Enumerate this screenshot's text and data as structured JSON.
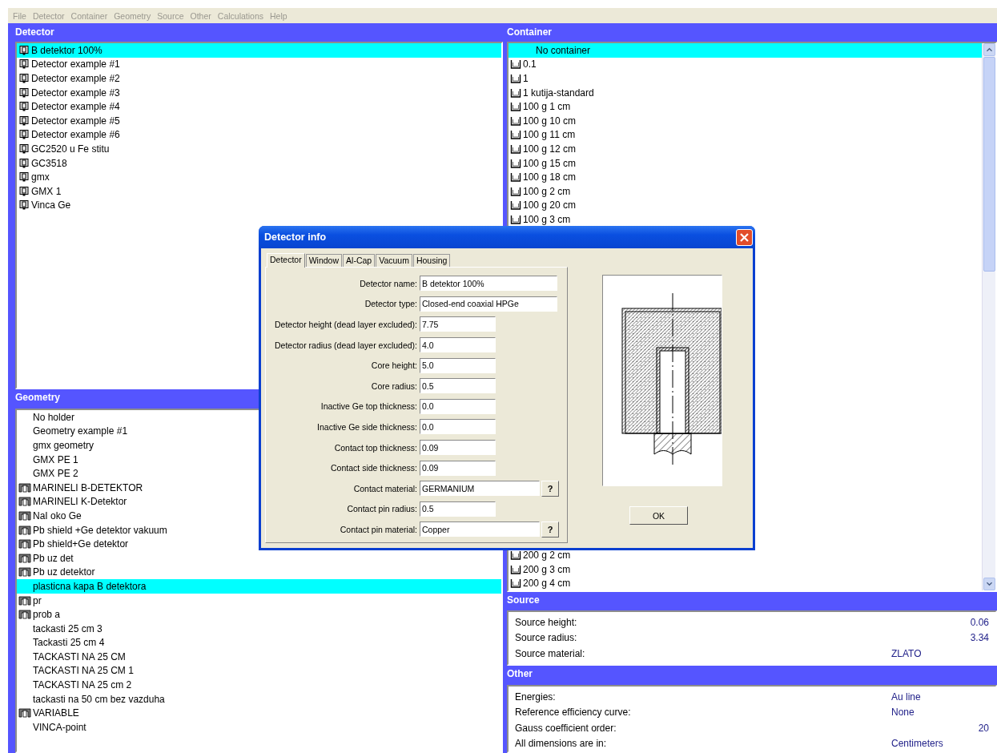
{
  "menu": [
    "File",
    "Detector",
    "Container",
    "Geometry",
    "Source",
    "Other",
    "Calculations",
    "Help"
  ],
  "detector": {
    "title": "Detector",
    "items": [
      {
        "label": "B detektor 100%",
        "selected": true
      },
      {
        "label": "Detector example #1",
        "selected": false
      },
      {
        "label": "Detector example #2",
        "selected": false
      },
      {
        "label": "Detector example #3",
        "selected": false
      },
      {
        "label": "Detector example #4",
        "selected": false
      },
      {
        "label": "Detector example #5",
        "selected": false
      },
      {
        "label": "Detector example #6",
        "selected": false
      },
      {
        "label": "GC2520 u Fe stitu",
        "selected": false
      },
      {
        "label": "GC3518",
        "selected": false
      },
      {
        "label": "gmx",
        "selected": false
      },
      {
        "label": "GMX 1",
        "selected": false
      },
      {
        "label": "Vinca Ge",
        "selected": false
      }
    ]
  },
  "geometry": {
    "title": "Geometry",
    "items": [
      {
        "label": "No holder",
        "icon": false,
        "selected": false
      },
      {
        "label": "Geometry example #1",
        "icon": false,
        "selected": false
      },
      {
        "label": "gmx geometry",
        "icon": false,
        "selected": false
      },
      {
        "label": "GMX PE 1",
        "icon": false,
        "selected": false
      },
      {
        "label": "GMX PE 2",
        "icon": false,
        "selected": false
      },
      {
        "label": "MARINELI B-DETEKTOR",
        "icon": true,
        "selected": false
      },
      {
        "label": "MARINELI K-Detektor",
        "icon": true,
        "selected": false
      },
      {
        "label": "NaI oko Ge",
        "icon": true,
        "selected": false
      },
      {
        "label": "Pb shield +Ge detektor vakuum",
        "icon": true,
        "selected": false
      },
      {
        "label": "Pb shield+Ge detektor",
        "icon": true,
        "selected": false
      },
      {
        "label": "Pb uz det",
        "icon": true,
        "selected": false
      },
      {
        "label": "Pb uz detektor",
        "icon": true,
        "selected": false
      },
      {
        "label": "plasticna kapa B detektora",
        "icon": false,
        "selected": true
      },
      {
        "label": "pr",
        "icon": true,
        "selected": false
      },
      {
        "label": "prob a",
        "icon": true,
        "selected": false
      },
      {
        "label": "tackasti 25 cm 3",
        "icon": false,
        "selected": false
      },
      {
        "label": "Tackasti 25 cm 4",
        "icon": false,
        "selected": false
      },
      {
        "label": "TACKASTI NA 25 CM",
        "icon": false,
        "selected": false
      },
      {
        "label": "TACKASTI NA 25 CM 1",
        "icon": false,
        "selected": false
      },
      {
        "label": "TACKASTI NA 25 cm 2",
        "icon": false,
        "selected": false
      },
      {
        "label": "tackasti na 50 cm bez vazduha",
        "icon": false,
        "selected": false
      },
      {
        "label": "VARIABLE",
        "icon": true,
        "selected": false
      },
      {
        "label": "VINCA-point",
        "icon": false,
        "selected": false
      }
    ]
  },
  "container": {
    "title": "Container",
    "items_top": [
      {
        "label": "No container",
        "icon": false,
        "selected": true
      },
      {
        "label": "0.1",
        "icon": true,
        "selected": false
      },
      {
        "label": "1",
        "icon": true,
        "selected": false
      },
      {
        "label": "1 kutija-standard",
        "icon": true,
        "selected": false
      },
      {
        "label": "100 g 1 cm",
        "icon": true,
        "selected": false
      },
      {
        "label": "100 g 10 cm",
        "icon": true,
        "selected": false
      },
      {
        "label": "100 g 11 cm",
        "icon": true,
        "selected": false
      },
      {
        "label": "100 g 12 cm",
        "icon": true,
        "selected": false
      },
      {
        "label": "100 g 15 cm",
        "icon": true,
        "selected": false
      },
      {
        "label": "100 g 18 cm",
        "icon": true,
        "selected": false
      },
      {
        "label": "100 g 2 cm",
        "icon": true,
        "selected": false
      },
      {
        "label": "100 g 20 cm",
        "icon": true,
        "selected": false
      },
      {
        "label": "100 g 3 cm",
        "icon": true,
        "selected": false
      }
    ],
    "items_bottom": [
      {
        "label": "200 g 2 cm",
        "icon": true,
        "selected": false
      },
      {
        "label": "200 g 3 cm",
        "icon": true,
        "selected": false
      },
      {
        "label": "200 g 4 cm",
        "icon": true,
        "selected": false
      }
    ]
  },
  "source": {
    "title": "Source",
    "rows": [
      {
        "label": "Source height:",
        "value": "0.06",
        "kind": "number"
      },
      {
        "label": "Source radius:",
        "value": "3.34",
        "kind": "number"
      },
      {
        "label": "Source material:",
        "value": "ZLATO",
        "kind": "text"
      }
    ]
  },
  "other": {
    "title": "Other",
    "rows": [
      {
        "label": "Energies:",
        "value": "Au line",
        "kind": "text"
      },
      {
        "label": "Reference efficiency curve:",
        "value": "None",
        "kind": "text"
      },
      {
        "label": "Gauss coefficient order:",
        "value": "20",
        "kind": "number"
      },
      {
        "label": "All dimensions are in:",
        "value": "Centimeters",
        "kind": "text"
      }
    ]
  },
  "dialog": {
    "title": "Detector info",
    "tabs": [
      {
        "label": "Detector",
        "selected": true
      },
      {
        "label": "Window",
        "selected": false
      },
      {
        "label": "Al-Cap",
        "selected": false
      },
      {
        "label": "Vacuum",
        "selected": false
      },
      {
        "label": "Housing",
        "selected": false
      }
    ],
    "fields": [
      {
        "label": "Detector name:",
        "value": "B detektor 100%",
        "kind": "long"
      },
      {
        "label": "Detector type:",
        "value": "Closed-end coaxial HPGe",
        "kind": "long"
      },
      {
        "label": "Detector height (dead layer excluded):",
        "value": "7.75",
        "kind": "short"
      },
      {
        "label": "Detector radius (dead layer excluded):",
        "value": "4.0",
        "kind": "short"
      },
      {
        "label": "Core height:",
        "value": "5.0",
        "kind": "short"
      },
      {
        "label": "Core radius:",
        "value": "0.5",
        "kind": "short"
      },
      {
        "label": "Inactive Ge top thickness:",
        "value": "0.0",
        "kind": "short"
      },
      {
        "label": "Inactive Ge side thickness:",
        "value": "0.0",
        "kind": "short"
      },
      {
        "label": "Contact top thickness:",
        "value": "0.09",
        "kind": "short"
      },
      {
        "label": "Contact side thickness:",
        "value": "0.09",
        "kind": "short"
      },
      {
        "label": "Contact material:",
        "value": "GERMANIUM",
        "kind": "lookup",
        "button": "?"
      },
      {
        "label": "Contact pin radius:",
        "value": "0.5",
        "kind": "short"
      },
      {
        "label": "Contact pin material:",
        "value": "Copper",
        "kind": "lookup",
        "button": "?"
      }
    ],
    "ok": "OK"
  }
}
